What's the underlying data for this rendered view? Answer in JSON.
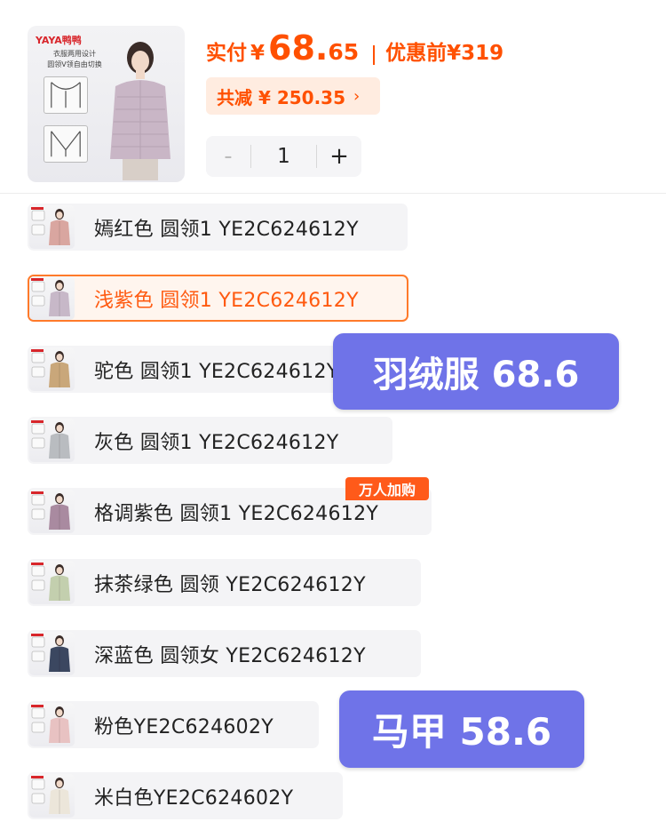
{
  "product": {
    "thumb_brand": "YAYA鸭鸭",
    "thumb_caption_1": "衣服两用设计",
    "thumb_caption_2": "圆领V领自由切换"
  },
  "price": {
    "paid_label": "实付",
    "currency": "¥",
    "paid_int": "68.",
    "paid_dec": "65",
    "orig_label": "优惠前¥319",
    "accent_color": "#ff5000"
  },
  "discount": {
    "label": "共减 ¥ 250.35",
    "chevron": "›"
  },
  "quantity": {
    "minus": "-",
    "value": "1",
    "plus": "+"
  },
  "variants": [
    {
      "label": "嫣红色  圆领1 YE2C624612Y",
      "color": "#d9a6a0",
      "selected": false
    },
    {
      "label": "浅紫色  圆领1 YE2C624612Y",
      "color": "#c7b8c8",
      "selected": true
    },
    {
      "label": "驼色   圆领1 YE2C624612Y",
      "color": "#c9a77a",
      "selected": false
    },
    {
      "label": "灰色   圆领1 YE2C624612Y",
      "color": "#b9bcc0",
      "selected": false
    },
    {
      "label": "格调紫色  圆领1 YE2C624612Y",
      "color": "#a98aa0",
      "selected": false
    },
    {
      "label": "抹茶绿色  圆领  YE2C624612Y",
      "color": "#c3cfae",
      "selected": false
    },
    {
      "label": "深蓝色  圆领女  YE2C624612Y",
      "color": "#3b4760",
      "selected": false
    },
    {
      "label": "粉色YE2C624602Y",
      "color": "#e8c2c2",
      "selected": false
    },
    {
      "label": "米白色YE2C624602Y",
      "color": "#ece6da",
      "selected": false
    }
  ],
  "hot_badge": "万人加购",
  "overlays": {
    "down_jacket": "羽绒服 68.6",
    "vest": "马甲 58.6",
    "color": "#6f73e8"
  }
}
